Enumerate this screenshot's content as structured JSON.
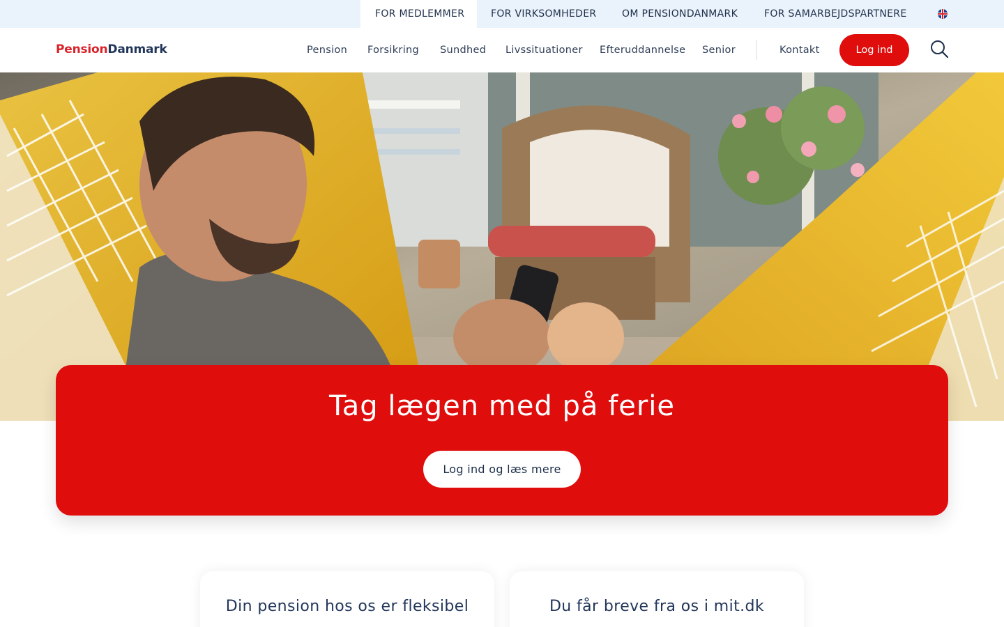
{
  "topbar": {
    "links": [
      {
        "label": "FOR MEDLEMMER",
        "active": true
      },
      {
        "label": "FOR VIRKSOMHEDER",
        "active": false
      },
      {
        "label": "OM PENSIONDANMARK",
        "active": false
      },
      {
        "label": "FOR SAMARBEJDSPARTNERE",
        "active": false
      }
    ],
    "language_icon": "uk-flag-icon"
  },
  "header": {
    "logo": {
      "part1": "Pension",
      "part2": "Danmark"
    },
    "nav": [
      "Pension",
      "Forsikring",
      "Sundhed",
      "Livssituationer",
      "Efteruddannelse",
      "Senior"
    ],
    "contact": "Kontakt",
    "login": "Log ind",
    "search_icon": "search-icon"
  },
  "hero": {
    "image": "man-in-hammock-with-phone"
  },
  "promo": {
    "title": "Tag lægen med på ferie",
    "cta": "Log ind og læs mere"
  },
  "cards": [
    {
      "title": "Din pension hos os er fleksibel"
    },
    {
      "title": "Du får breve fra os i mit.dk"
    }
  ],
  "colors": {
    "brand_red": "#e00d0d",
    "navy": "#22365a",
    "topbar_bg": "#eaf2fb"
  }
}
